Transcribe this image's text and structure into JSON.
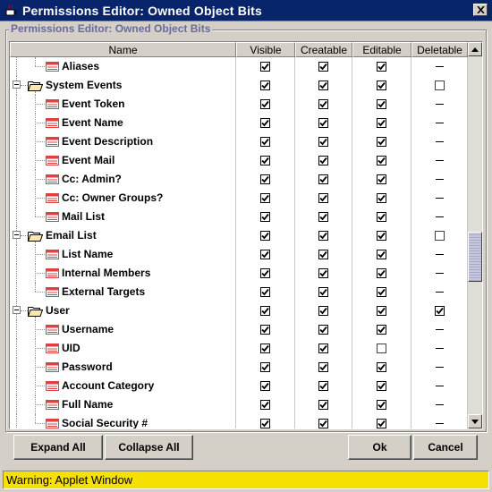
{
  "window": {
    "title": "Permissions Editor: Owned Object Bits",
    "close_label": "✕"
  },
  "group_title": "Permissions Editor: Owned Object Bits",
  "table": {
    "columns": [
      "Name",
      "Visible",
      "Creatable",
      "Editable",
      "Deletable"
    ],
    "rows": [
      {
        "kind": "field",
        "name": "Aliases",
        "visible": "checked",
        "creatable": "checked",
        "editable": "checked",
        "deletable": "na"
      },
      {
        "kind": "group",
        "name": "System Events",
        "visible": "checked",
        "creatable": "checked",
        "editable": "checked",
        "deletable": "unchecked"
      },
      {
        "kind": "field",
        "name": "Event Token",
        "visible": "checked",
        "creatable": "checked",
        "editable": "checked",
        "deletable": "na"
      },
      {
        "kind": "field",
        "name": "Event Name",
        "visible": "checked",
        "creatable": "checked",
        "editable": "checked",
        "deletable": "na"
      },
      {
        "kind": "field",
        "name": "Event Description",
        "visible": "checked",
        "creatable": "checked",
        "editable": "checked",
        "deletable": "na"
      },
      {
        "kind": "field",
        "name": "Event Mail",
        "visible": "checked",
        "creatable": "checked",
        "editable": "checked",
        "deletable": "na"
      },
      {
        "kind": "field",
        "name": "Cc: Admin?",
        "visible": "checked",
        "creatable": "checked",
        "editable": "checked",
        "deletable": "na"
      },
      {
        "kind": "field",
        "name": "Cc: Owner Groups?",
        "visible": "checked",
        "creatable": "checked",
        "editable": "checked",
        "deletable": "na"
      },
      {
        "kind": "field",
        "name": "Mail List",
        "visible": "checked",
        "creatable": "checked",
        "editable": "checked",
        "deletable": "na"
      },
      {
        "kind": "group",
        "name": "Email List",
        "visible": "checked",
        "creatable": "checked",
        "editable": "checked",
        "deletable": "unchecked"
      },
      {
        "kind": "field",
        "name": "List Name",
        "visible": "checked",
        "creatable": "checked",
        "editable": "checked",
        "deletable": "na"
      },
      {
        "kind": "field",
        "name": "Internal Members",
        "visible": "checked",
        "creatable": "checked",
        "editable": "checked",
        "deletable": "na"
      },
      {
        "kind": "field",
        "name": "External Targets",
        "visible": "checked",
        "creatable": "checked",
        "editable": "checked",
        "deletable": "na"
      },
      {
        "kind": "group",
        "name": "User",
        "visible": "checked",
        "creatable": "checked",
        "editable": "checked",
        "deletable": "checked"
      },
      {
        "kind": "field",
        "name": "Username",
        "visible": "checked",
        "creatable": "checked",
        "editable": "checked",
        "deletable": "na"
      },
      {
        "kind": "field",
        "name": "UID",
        "visible": "checked",
        "creatable": "checked",
        "editable": "unchecked",
        "deletable": "na"
      },
      {
        "kind": "field",
        "name": "Password",
        "visible": "checked",
        "creatable": "checked",
        "editable": "checked",
        "deletable": "na"
      },
      {
        "kind": "field",
        "name": "Account Category",
        "visible": "checked",
        "creatable": "checked",
        "editable": "checked",
        "deletable": "na"
      },
      {
        "kind": "field",
        "name": "Full Name",
        "visible": "checked",
        "creatable": "checked",
        "editable": "checked",
        "deletable": "na"
      },
      {
        "kind": "field",
        "name": "Social Security #",
        "visible": "checked",
        "creatable": "checked",
        "editable": "checked",
        "deletable": "na"
      }
    ]
  },
  "buttons": {
    "expand_all": "Expand All",
    "collapse_all": "Collapse All",
    "ok": "Ok",
    "cancel": "Cancel"
  },
  "status_text": "Warning: Applet Window",
  "colors": {
    "titlebar": "#08246b",
    "status_background": "#f5e000",
    "field_icon": "#e04040"
  },
  "icons": {
    "app": "java-cup-icon",
    "group_node": "open-folder-icon",
    "field_node": "field-icon",
    "expander": "collapse-minus-icon"
  }
}
